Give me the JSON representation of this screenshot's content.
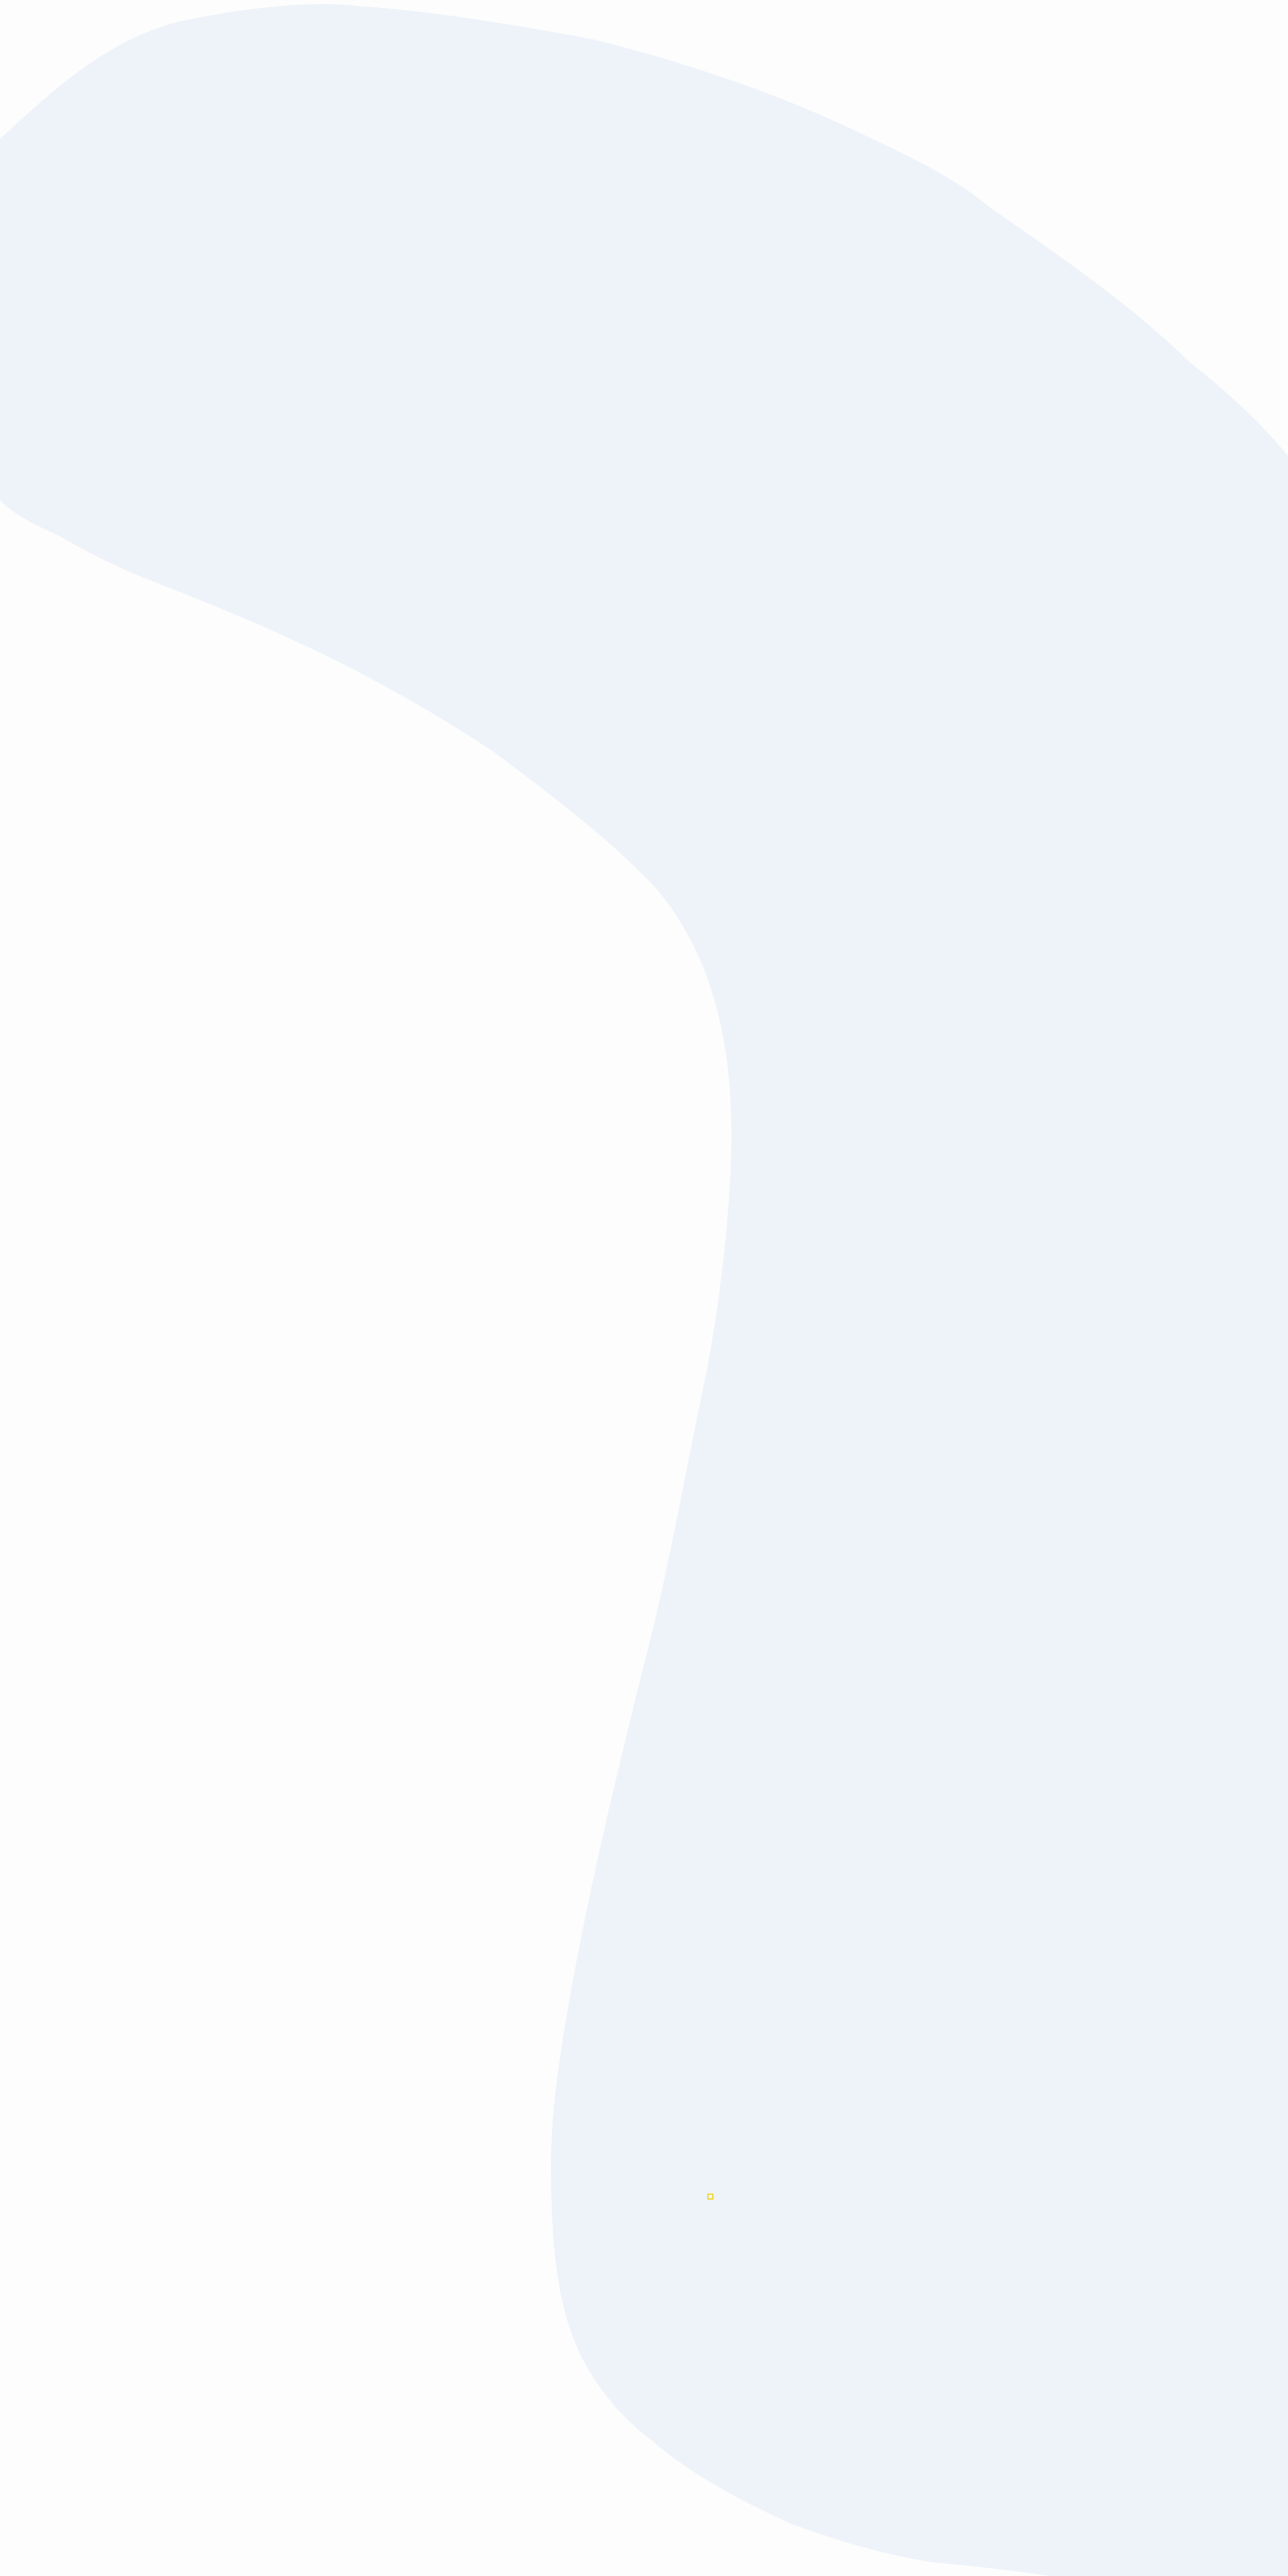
{
  "colors": {
    "page_background": "#fdfdfd",
    "blob_fill": "#eef3fa",
    "marker_outline": "#f2d200"
  },
  "shapes": {
    "blob": "decorative-organic-shape",
    "marker": "small-square-outline"
  }
}
